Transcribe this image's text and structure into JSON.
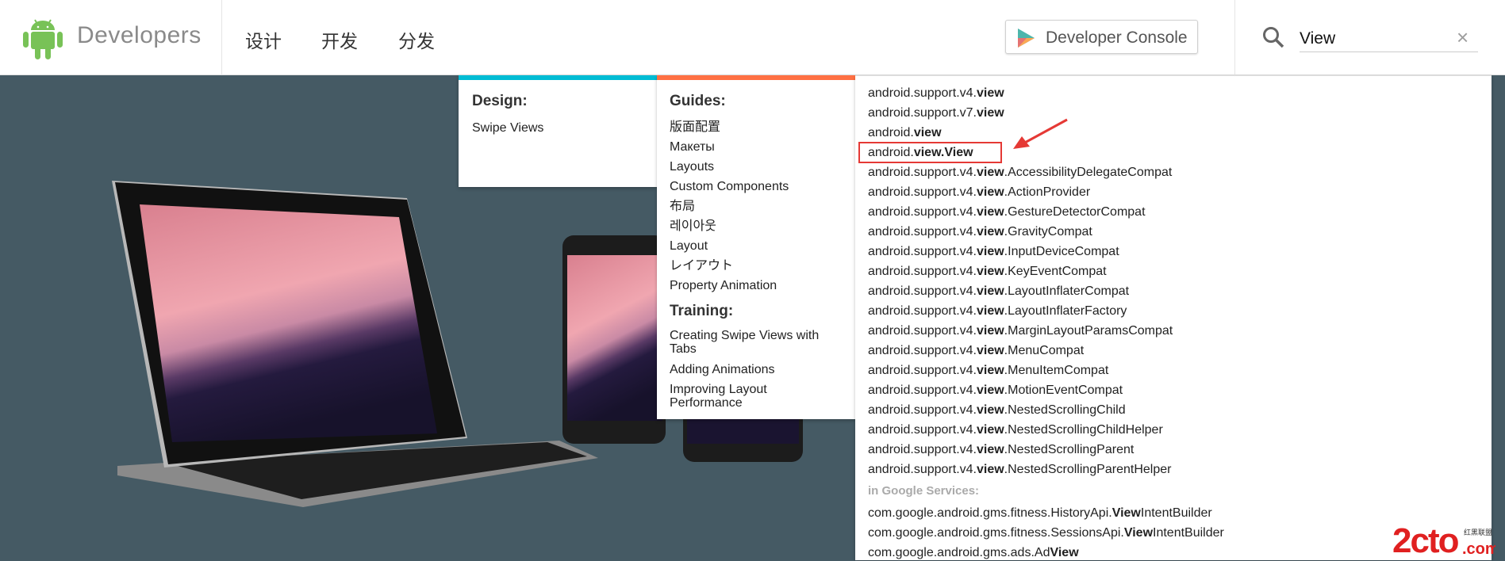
{
  "header": {
    "brand": "Developers",
    "nav": [
      "设计",
      "开发",
      "分发"
    ],
    "console_button": "Developer Console",
    "search_value": "View",
    "clear_icon": "×",
    "colors": {
      "android_green": "#78c257",
      "design_accent": "#00bcd4",
      "develop_accent": "#ff7043",
      "hero_bg": "#455a64"
    }
  },
  "design": {
    "heading": "Design:",
    "items": [
      "Swipe Views"
    ]
  },
  "guides": {
    "heading": "Guides:",
    "items": [
      "版面配置",
      "Макеты",
      "Layouts",
      "Custom Components",
      "布局",
      "레이아웃",
      "Layout",
      "レイアウト",
      "Property Animation"
    ],
    "training_heading": "Training:",
    "training": [
      "Creating Swipe Views with Tabs",
      "Adding Animations",
      "Improving Layout Performance"
    ]
  },
  "results": {
    "items": [
      {
        "pre": "android.support.v4.",
        "bold": "view",
        "post": ""
      },
      {
        "pre": "android.support.v7.",
        "bold": "view",
        "post": ""
      },
      {
        "pre": "android.",
        "bold": "view",
        "post": ""
      },
      {
        "pre": "android.",
        "bold": "view.View",
        "post": ""
      },
      {
        "pre": "android.support.v4.",
        "bold": "view",
        "post": ".AccessibilityDelegateCompat"
      },
      {
        "pre": "android.support.v4.",
        "bold": "view",
        "post": ".ActionProvider"
      },
      {
        "pre": "android.support.v4.",
        "bold": "view",
        "post": ".GestureDetectorCompat"
      },
      {
        "pre": "android.support.v4.",
        "bold": "view",
        "post": ".GravityCompat"
      },
      {
        "pre": "android.support.v4.",
        "bold": "view",
        "post": ".InputDeviceCompat"
      },
      {
        "pre": "android.support.v4.",
        "bold": "view",
        "post": ".KeyEventCompat"
      },
      {
        "pre": "android.support.v4.",
        "bold": "view",
        "post": ".LayoutInflaterCompat"
      },
      {
        "pre": "android.support.v4.",
        "bold": "view",
        "post": ".LayoutInflaterFactory"
      },
      {
        "pre": "android.support.v4.",
        "bold": "view",
        "post": ".MarginLayoutParamsCompat"
      },
      {
        "pre": "android.support.v4.",
        "bold": "view",
        "post": ".MenuCompat"
      },
      {
        "pre": "android.support.v4.",
        "bold": "view",
        "post": ".MenuItemCompat"
      },
      {
        "pre": "android.support.v4.",
        "bold": "view",
        "post": ".MotionEventCompat"
      },
      {
        "pre": "android.support.v4.",
        "bold": "view",
        "post": ".NestedScrollingChild"
      },
      {
        "pre": "android.support.v4.",
        "bold": "view",
        "post": ".NestedScrollingChildHelper"
      },
      {
        "pre": "android.support.v4.",
        "bold": "view",
        "post": ".NestedScrollingParent"
      },
      {
        "pre": "android.support.v4.",
        "bold": "view",
        "post": ".NestedScrollingParentHelper"
      }
    ],
    "google_services_heading": "in Google Services:",
    "google_items": [
      {
        "pre": "com.google.android.gms.fitness.HistoryApi.",
        "bold": "View",
        "post": "IntentBuilder"
      },
      {
        "pre": "com.google.android.gms.fitness.SessionsApi.",
        "bold": "View",
        "post": "IntentBuilder"
      },
      {
        "pre": "com.google.android.gms.ads.Ad",
        "bold": "View",
        "post": ""
      }
    ]
  },
  "watermark": {
    "text": "2cto",
    "suffix": ".com",
    "cn": "红黑联盟"
  }
}
